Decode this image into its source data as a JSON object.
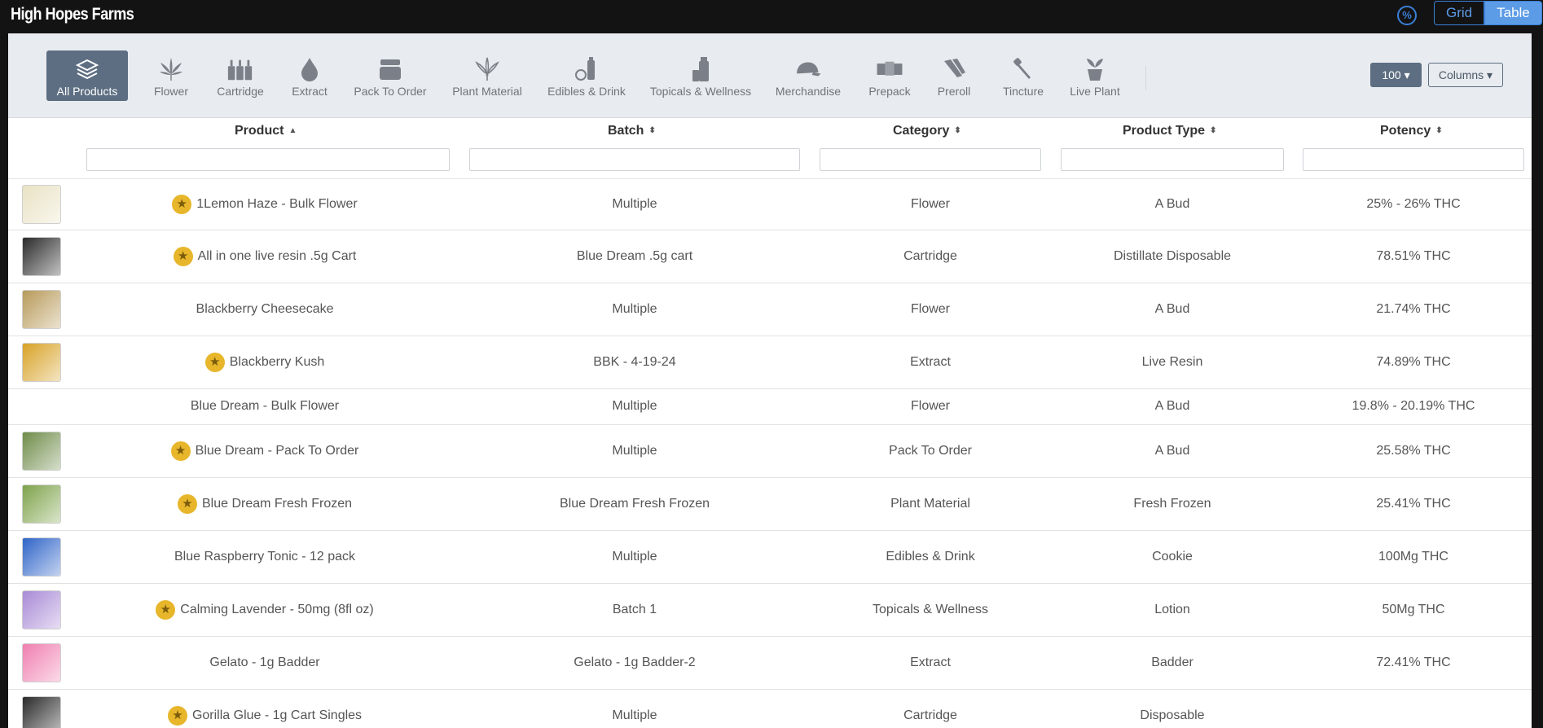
{
  "header": {
    "brand": "High Hopes Farms",
    "percent_icon": "percent-icon",
    "view_grid": "Grid",
    "view_table": "Table"
  },
  "categories": [
    {
      "label": "All Products",
      "icon": "layers-icon",
      "active": true
    },
    {
      "label": "Flower",
      "icon": "leaf-icon"
    },
    {
      "label": "Cartridge",
      "icon": "cartridge-icon"
    },
    {
      "label": "Extract",
      "icon": "drop-icon"
    },
    {
      "label": "Pack To Order",
      "icon": "jar-icon"
    },
    {
      "label": "Plant Material",
      "icon": "plant-leaf-icon"
    },
    {
      "label": "Edibles & Drink",
      "icon": "bottle-icon"
    },
    {
      "label": "Topicals & Wellness",
      "icon": "lotion-icon"
    },
    {
      "label": "Merchandise",
      "icon": "cap-icon"
    },
    {
      "label": "Prepack",
      "icon": "packs-icon"
    },
    {
      "label": "Preroll",
      "icon": "preroll-icon"
    },
    {
      "label": "Tincture",
      "icon": "dropper-icon"
    },
    {
      "label": "Live Plant",
      "icon": "potted-plant-icon"
    }
  ],
  "controls": {
    "page_size": "100",
    "columns_label": "Columns"
  },
  "table": {
    "headers": {
      "product": "Product",
      "batch": "Batch",
      "category": "Category",
      "product_type": "Product Type",
      "potency": "Potency"
    },
    "rows": [
      {
        "product": "1Lemon Haze - Bulk Flower",
        "featured": true,
        "thumb_color": "#e9e2c3",
        "batch": "Multiple",
        "category": "Flower",
        "type": "A Bud",
        "potency": "25% - 26% THC"
      },
      {
        "product": "All in one live resin .5g Cart",
        "featured": true,
        "thumb_color": "#2a2a2a",
        "batch": "Blue Dream .5g cart",
        "category": "Cartridge",
        "type": "Distillate Disposable",
        "potency": "78.51% THC"
      },
      {
        "product": "Blackberry Cheesecake",
        "featured": false,
        "thumb_color": "#b89a5a",
        "batch": "Multiple",
        "category": "Flower",
        "type": "A Bud",
        "potency": "21.74% THC"
      },
      {
        "product": "Blackberry Kush",
        "featured": true,
        "thumb_color": "#d8a227",
        "batch": "BBK - 4-19-24",
        "category": "Extract",
        "type": "Live Resin",
        "potency": "74.89% THC"
      },
      {
        "product": "Blue Dream - Bulk Flower",
        "featured": false,
        "thumb_color": "",
        "batch": "Multiple",
        "category": "Flower",
        "type": "A Bud",
        "potency": "19.8% - 20.19% THC"
      },
      {
        "product": "Blue Dream - Pack To Order",
        "featured": true,
        "thumb_color": "#6f8c4a",
        "batch": "Multiple",
        "category": "Pack To Order",
        "type": "A Bud",
        "potency": "25.58% THC"
      },
      {
        "product": "Blue Dream Fresh Frozen",
        "featured": true,
        "thumb_color": "#7ea34a",
        "batch": "Blue Dream Fresh Frozen",
        "category": "Plant Material",
        "type": "Fresh Frozen",
        "potency": "25.41% THC"
      },
      {
        "product": "Blue Raspberry Tonic - 12 pack",
        "featured": false,
        "thumb_color": "#2f64c8",
        "batch": "Multiple",
        "category": "Edibles & Drink",
        "type": "Cookie",
        "potency": "100Mg THC"
      },
      {
        "product": "Calming Lavender - 50mg (8fl oz)",
        "featured": true,
        "thumb_color": "#a98ad6",
        "batch": "Batch 1",
        "category": "Topicals & Wellness",
        "type": "Lotion",
        "potency": "50Mg THC"
      },
      {
        "product": "Gelato - 1g Badder",
        "featured": false,
        "thumb_color": "#f07fb0",
        "batch": "Gelato - 1g Badder-2",
        "category": "Extract",
        "type": "Badder",
        "potency": "72.41% THC"
      },
      {
        "product": "Gorilla Glue - 1g Cart Singles",
        "featured": true,
        "thumb_color": "#2a2a2a",
        "batch": "Multiple",
        "category": "Cartridge",
        "type": "Disposable",
        "potency": ""
      }
    ]
  }
}
